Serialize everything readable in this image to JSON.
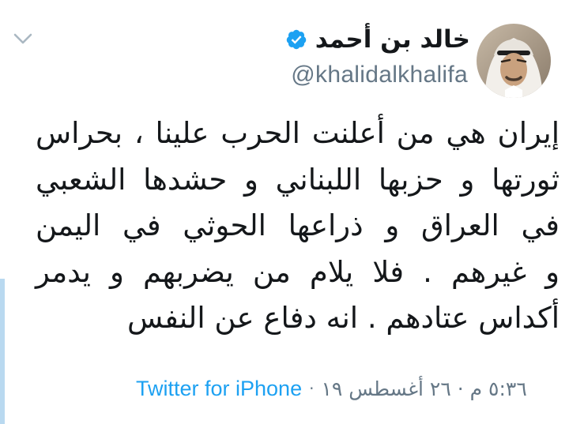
{
  "tweet": {
    "author": {
      "display_name": "خالد بن أحمد",
      "handle": "@khalidalkhalifa",
      "verified": true
    },
    "text_lines": [
      "إيران هي من أعلنت الحرب علينا ، بحراس",
      "ثورتها و حزبها اللبناني و حشدها الشعبي",
      "في العراق و ذراعها الحوثي في اليمن",
      "و غيرهم . فلا يلام من يضربهم و يدمر",
      "أكداس عتادهم . انه دفاع عن النفس"
    ],
    "timestamp": "٥:٣٦ م · ٢٦ أغسطس ١٩",
    "separator": "·",
    "source": "Twitter for iPhone"
  },
  "colors": {
    "accent": "#1da1f2",
    "text": "#14171a",
    "secondary": "#657786",
    "left_accent_bar": "#b9d9f0"
  },
  "icons": {
    "menu": "chevron-down-icon",
    "verified": "verified-badge-icon"
  }
}
